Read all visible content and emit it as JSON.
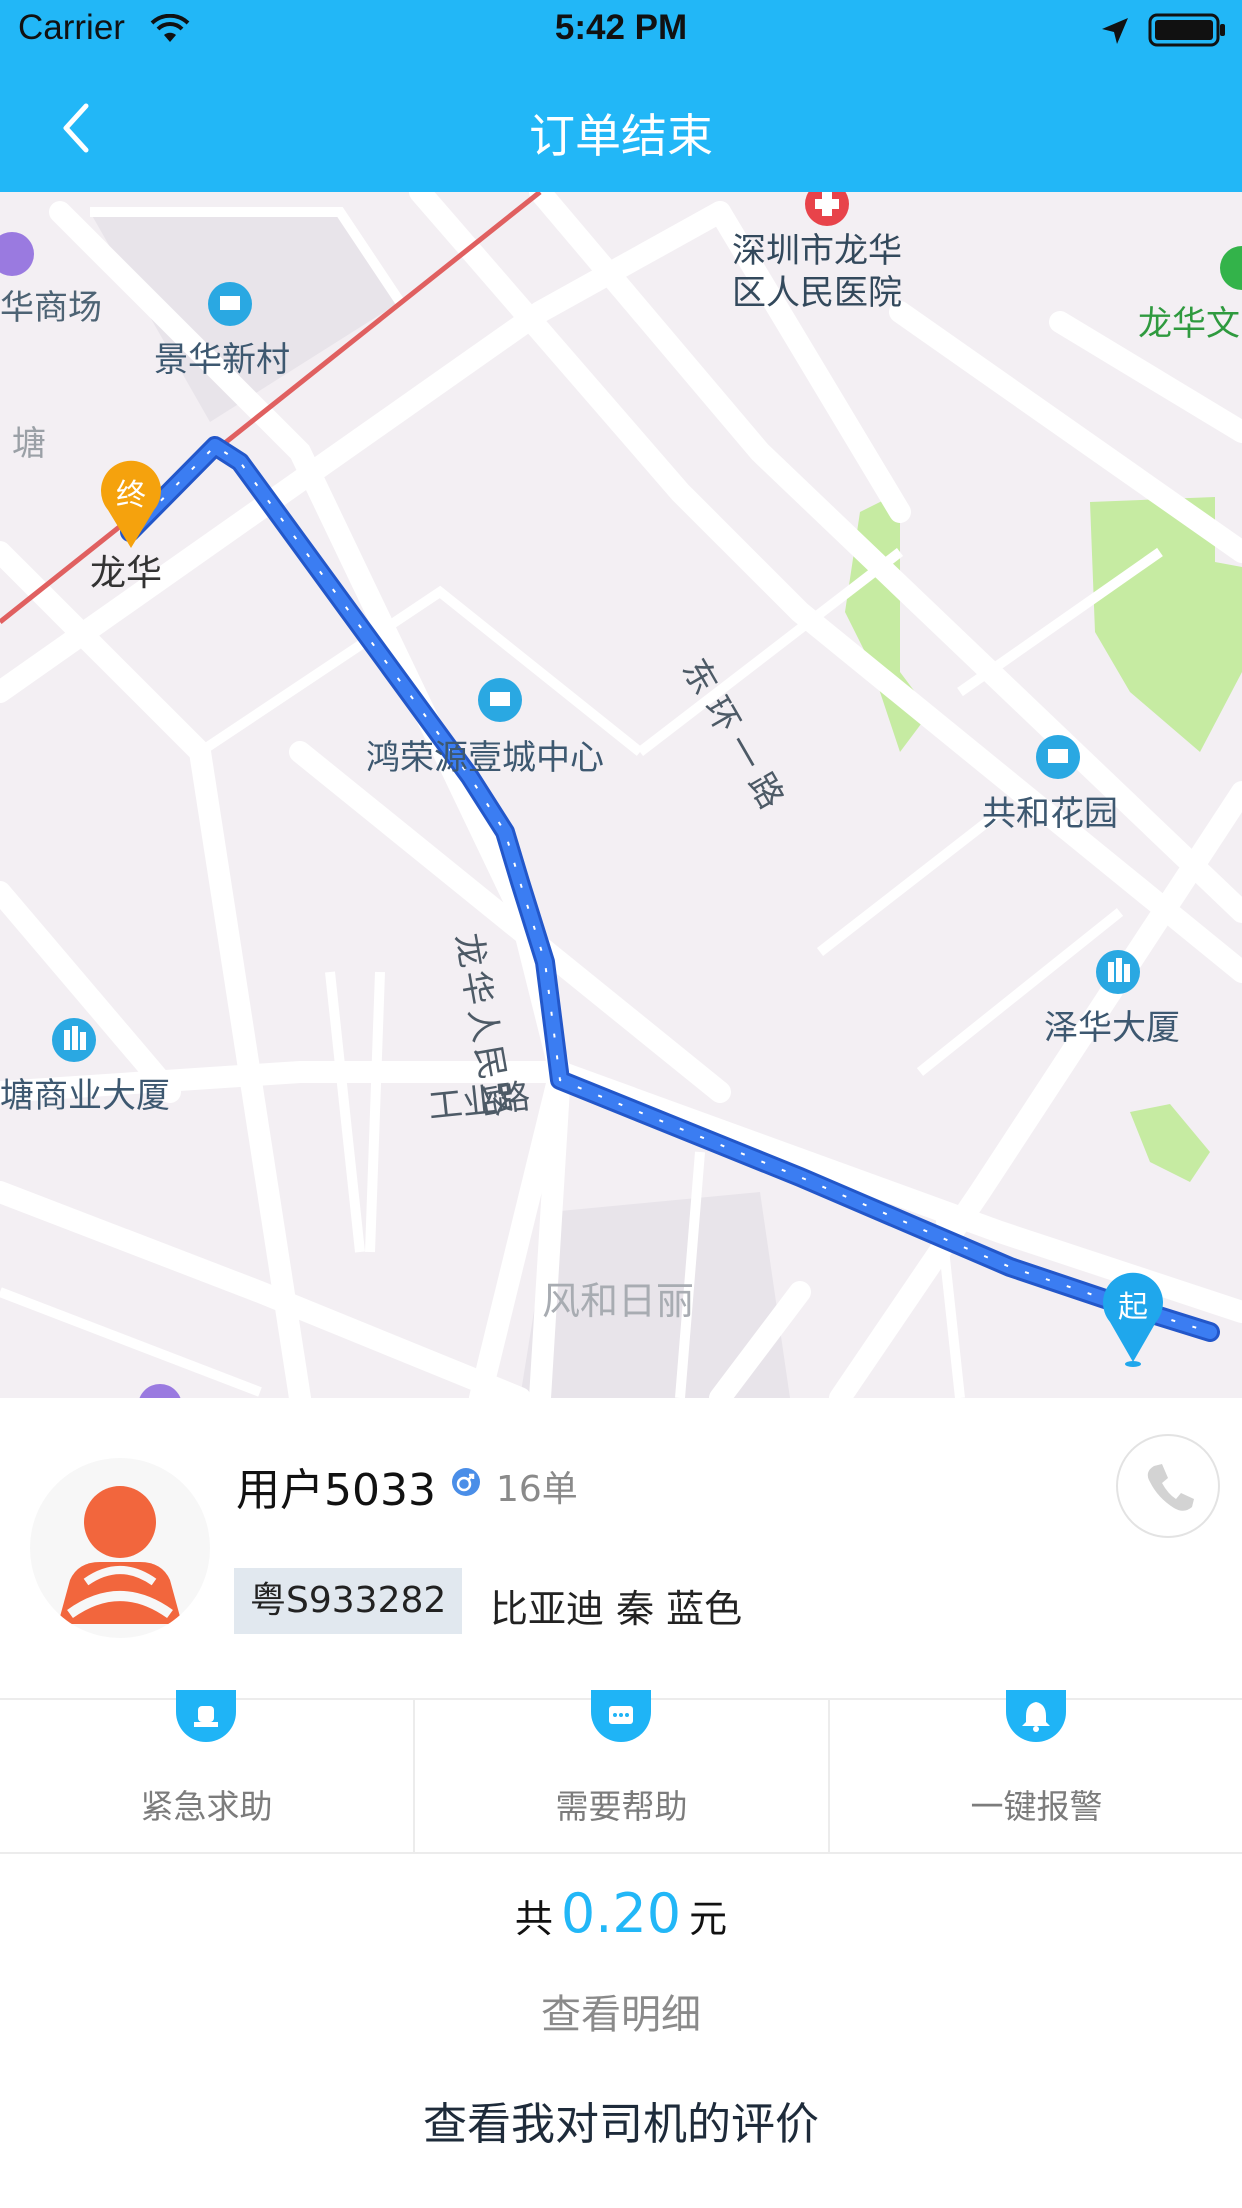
{
  "status_bar": {
    "carrier": "Carrier",
    "time": "5:42 PM"
  },
  "nav": {
    "title": "订单结束"
  },
  "map": {
    "labels": {
      "hospital": "深圳市龙华\n区人民医院",
      "mall": "华商场",
      "jinghua": "景华新村",
      "tang": "塘",
      "longhua": "龙华",
      "longhua_culture": "龙华文",
      "donghuan": "东环一路",
      "hongrong": "鸿荣源壹城中心",
      "gonghe": "共和花园",
      "longhua_road": "龙华人民路",
      "gongye": "工业路",
      "zehua": "泽华大厦",
      "tangshang": "塘商业大厦",
      "fenghe": "风和日丽"
    },
    "end_marker": "终",
    "start_marker": "起"
  },
  "driver": {
    "name": "用户5033",
    "orders": "16单",
    "plate": "粤S933282",
    "car": "比亚迪 秦 蓝色"
  },
  "actions": [
    {
      "label": "紧急求助",
      "icon": "siren-icon"
    },
    {
      "label": "需要帮助",
      "icon": "chat-icon"
    },
    {
      "label": "一键报警",
      "icon": "bell-icon"
    }
  ],
  "fare": {
    "prefix": "共",
    "amount": "0.20",
    "unit": "元"
  },
  "links": {
    "detail": "查看明细",
    "rating": "查看我对司机的评价"
  },
  "colors": {
    "primary": "#22b7f7",
    "route": "#2f6fe8",
    "end_marker": "#f5a20d",
    "avatar": "#f2663d"
  }
}
